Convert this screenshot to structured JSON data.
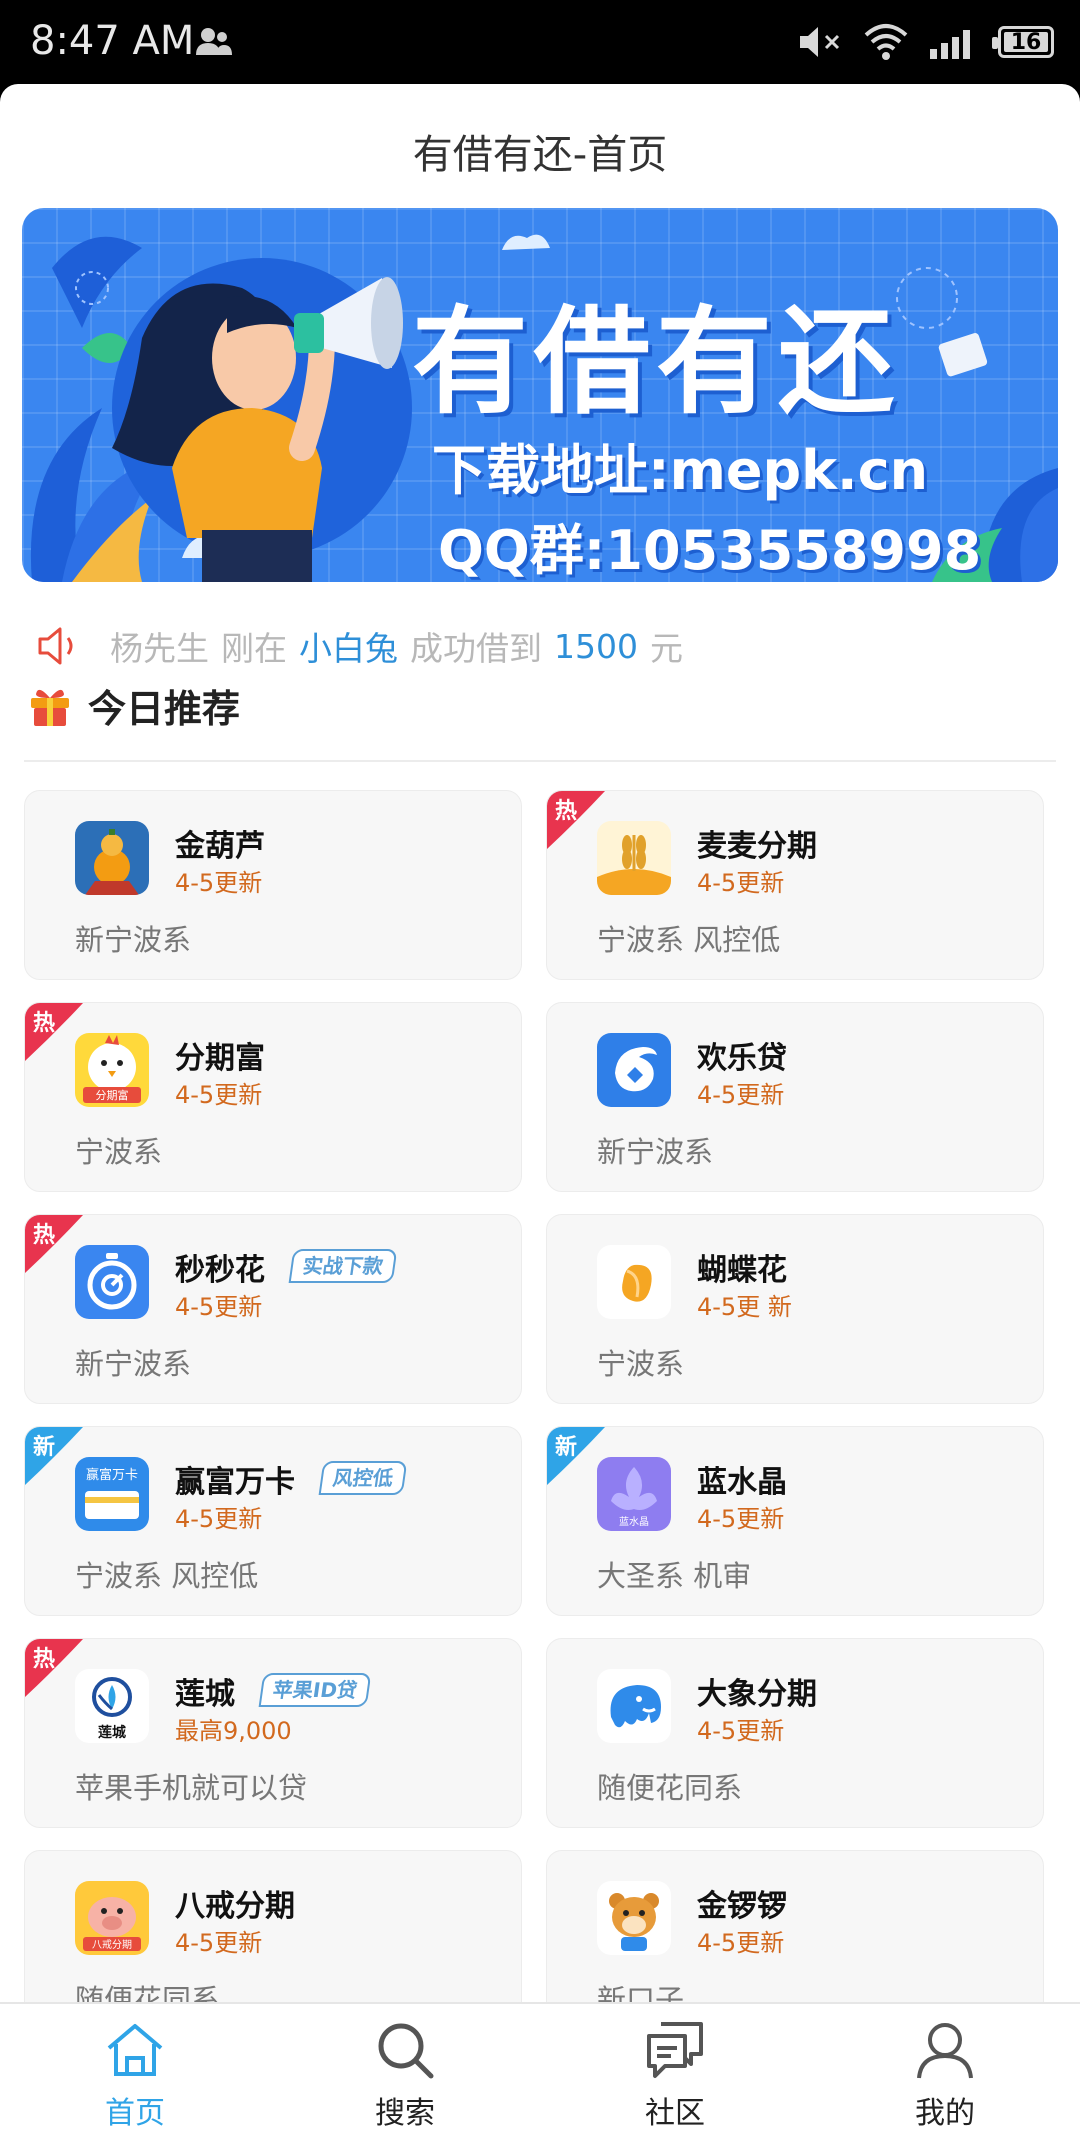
{
  "status": {
    "time": "8:47 AM",
    "battery": "16"
  },
  "header": {
    "title": "有借有还-首页"
  },
  "banner": {
    "title": "有借有还",
    "line1": "下载地址:mepk.cn",
    "line2": "QQ群:1053558998"
  },
  "notice": {
    "name": "杨先生",
    "pre": "刚在",
    "app": "小白兔",
    "mid": "成功借到",
    "amount": "1500",
    "unit": "元"
  },
  "section": {
    "title": "今日推荐"
  },
  "cards": [
    {
      "name": "金葫芦",
      "update": "4-5更新",
      "desc": "新宁波系",
      "badge": "",
      "tag": ""
    },
    {
      "name": "麦麦分期",
      "update": "4-5更新",
      "desc": "宁波系 风控低",
      "badge": "热",
      "tag": ""
    },
    {
      "name": "分期富",
      "update": "4-5更新",
      "desc": "宁波系",
      "badge": "热",
      "tag": ""
    },
    {
      "name": "欢乐贷",
      "update": "4-5更新",
      "desc": "新宁波系",
      "badge": "",
      "tag": ""
    },
    {
      "name": "秒秒花",
      "update": "4-5更新",
      "desc": "新宁波系",
      "badge": "热",
      "tag": "实战下款"
    },
    {
      "name": "蝴蝶花",
      "update": "4-5更 新",
      "desc": "宁波系",
      "badge": "",
      "tag": ""
    },
    {
      "name": "赢富万卡",
      "update": "4-5更新",
      "desc": "宁波系 风控低",
      "badge": "新",
      "tag": "风控低"
    },
    {
      "name": "蓝水晶",
      "update": "4-5更新",
      "desc": "大圣系 机审",
      "badge": "新",
      "tag": ""
    },
    {
      "name": "莲城",
      "update": "最高9,000",
      "desc": "苹果手机就可以贷",
      "badge": "热",
      "tag": "苹果ID贷"
    },
    {
      "name": "大象分期",
      "update": "4-5更新",
      "desc": "随便花同系",
      "badge": "",
      "tag": ""
    },
    {
      "name": "八戒分期",
      "update": "4-5更新",
      "desc": "随便花同系",
      "badge": "",
      "tag": ""
    },
    {
      "name": "金锣锣",
      "update": "4-5更新",
      "desc": "新口子",
      "badge": "",
      "tag": ""
    }
  ],
  "icon_labels": {
    "fenqifu": "分期富",
    "yingfu": "赢富万卡",
    "lanshuijing": "蓝水晶",
    "liancheng": "莲城",
    "bajie": "八戒分期"
  },
  "tabs": [
    {
      "label": "首页",
      "icon": "home-icon",
      "active": true
    },
    {
      "label": "搜索",
      "icon": "search-icon",
      "active": false
    },
    {
      "label": "社区",
      "icon": "community-icon",
      "active": false
    },
    {
      "label": "我的",
      "icon": "profile-icon",
      "active": false
    }
  ],
  "colors": {
    "accent": "#2fa4e7",
    "hot_badge": "#e8344e",
    "new_badge": "#2fa4e7",
    "update_text": "#d2691e",
    "banner_bg": "#3a86f0"
  }
}
